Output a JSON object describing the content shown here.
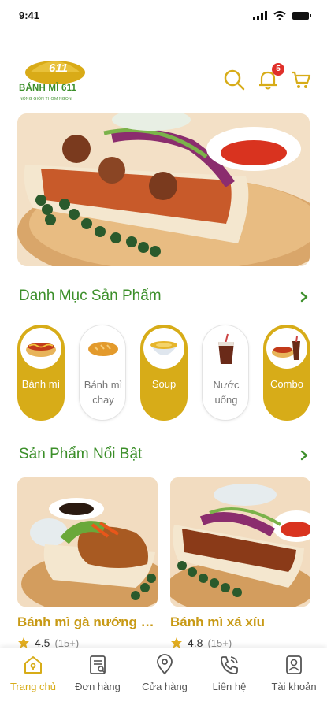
{
  "status": {
    "time": "9:41"
  },
  "header": {
    "brand": "BÁNH MÌ 611",
    "tagline": "NÓNG GIÒN THƠM NGON",
    "notification_count": "5",
    "icons": [
      "search-icon",
      "bell-icon",
      "cart-icon"
    ]
  },
  "categories_section": {
    "title": "Danh Mục Sản Phẩm",
    "items": [
      {
        "label": "Bánh mì",
        "active": true,
        "icon": "hotdog-icon"
      },
      {
        "label": "Bánh mì chay",
        "active": false,
        "icon": "bread-icon"
      },
      {
        "label": "Soup",
        "active": true,
        "icon": "soup-bowl-icon"
      },
      {
        "label": "Nước uống",
        "active": false,
        "icon": "drink-cup-icon"
      },
      {
        "label": "Combo",
        "active": true,
        "icon": "combo-icon"
      }
    ]
  },
  "featured_section": {
    "title": "Sản Phẩm Nổi Bật",
    "products": [
      {
        "name": "Bánh mì gà nướng mật ong",
        "rating": "4.5",
        "reviews": "(15+)"
      },
      {
        "name": "Bánh mì xá xíu",
        "rating": "4.8",
        "reviews": "(15+)"
      }
    ]
  },
  "nav": {
    "items": [
      {
        "label": "Trang chủ",
        "icon": "home-icon",
        "active": true
      },
      {
        "label": "Đơn hàng",
        "icon": "orders-icon",
        "active": false
      },
      {
        "label": "Cửa hàng",
        "icon": "location-pin-icon",
        "active": false
      },
      {
        "label": "Liên hệ",
        "icon": "phone-icon",
        "active": false
      },
      {
        "label": "Tài khoản",
        "icon": "account-icon",
        "active": false
      }
    ]
  },
  "colors": {
    "primary_green": "#3c8f2a",
    "accent_gold": "#d7ac18",
    "badge_red": "#e0302a"
  }
}
